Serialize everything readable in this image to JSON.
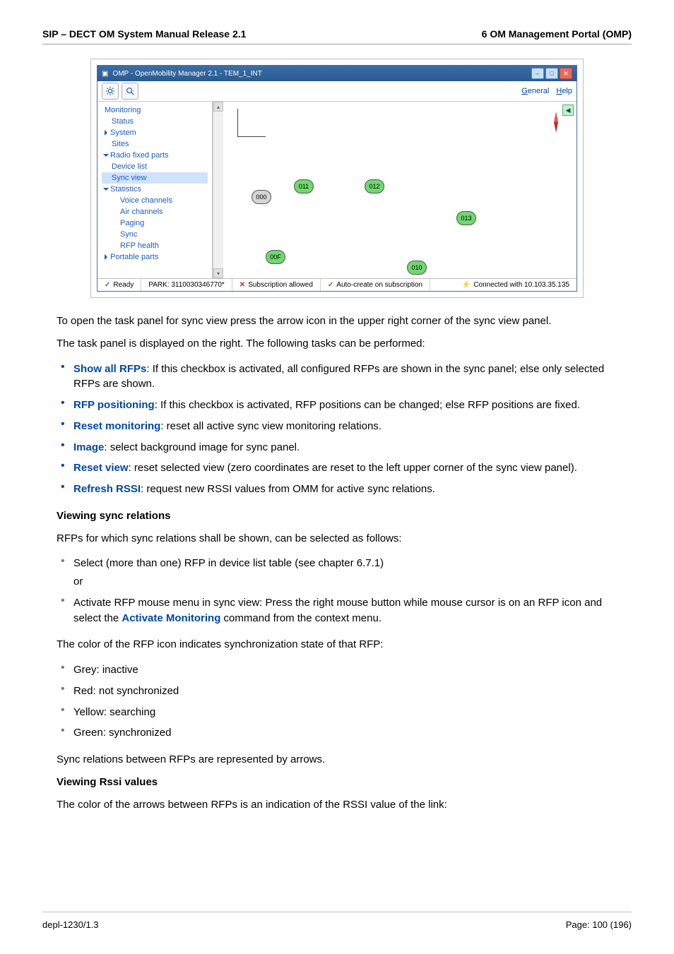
{
  "header": {
    "left": "SIP – DECT OM System Manual Release 2.1",
    "right": "6 OM Management Portal (OMP)"
  },
  "window": {
    "title": "OMP - OpenMobility Manager 2.1 - TEM_1_INT",
    "menu_general": "General",
    "menu_help": "Help"
  },
  "tree": {
    "monitoring": "Monitoring",
    "status": "Status",
    "system": "System",
    "sites": "Sites",
    "rfp": "Radio fixed parts",
    "device_list": "Device list",
    "sync_view": "Sync view",
    "statistics": "Statistics",
    "voice": "Voice channels",
    "air": "Air channels",
    "paging": "Paging",
    "sync": "Sync",
    "rfp_health": "RFP health",
    "portable": "Portable parts"
  },
  "nodes": {
    "n000_a": "000",
    "n011": "011",
    "n012": "012",
    "n013": "013",
    "n00f": "00F",
    "n010": "010"
  },
  "status": {
    "ready": "Ready",
    "park": "PARK: 3110030346770*",
    "sub": "Subscription allowed",
    "auto": "Auto-create on subscription",
    "conn": "Connected with 10.103.35.135"
  },
  "para": {
    "p1": "To open the task panel for sync view press the arrow icon in the upper right corner of the sync view panel.",
    "p2": "The task panel is displayed on the right. The following tasks can be performed:",
    "show_label": "Show all RFPs",
    "show_text": ": If this checkbox is activated, all configured RFPs are shown in the sync panel; else only selected RFPs are shown.",
    "pos_label": "RFP positioning",
    "pos_text": ": If this checkbox is activated, RFP positions can be changed; else RFP positions are fixed.",
    "reset_mon_label": "Reset monitoring",
    "reset_mon_text": ": reset all active sync view monitoring relations.",
    "image_label": "Image",
    "image_text": ": select background image for sync panel.",
    "reset_view_label": "Reset view",
    "reset_view_text": ": reset selected view (zero coordinates are reset to the left upper corner of the sync view panel).",
    "refresh_label": "Refresh RSSI",
    "refresh_text": ": request new RSSI values from OMM for active sync relations.",
    "vs_head": "Viewing sync relations",
    "vs_p1": "RFPs for which sync relations shall be shown, can be selected as follows:",
    "vs_li1": "Select (more than one) RFP in device list table (see chapter 6.7.1)",
    "vs_or": "or",
    "vs_li2a": "Activate RFP mouse menu in sync view: Press the right mouse button while mouse cursor is on an RFP icon and select the ",
    "vs_li2_label": "Activate Monitoring",
    "vs_li2b": " command from the context menu.",
    "vs_p2": "The color of the RFP icon indicates synchronization state of that RFP:",
    "c_grey": "Grey: inactive",
    "c_red": "Red: not synchronized",
    "c_yellow": "Yellow: searching",
    "c_green": "Green: synchronized",
    "vs_p3": "Sync relations between RFPs are represented by arrows.",
    "vr_head": "Viewing Rssi values",
    "vr_p1": "The color of the arrows between RFPs is an indication of the RSSI value of the link:"
  },
  "footer": {
    "left": "depl-1230/1.3",
    "right": "Page: 100 (196)"
  }
}
